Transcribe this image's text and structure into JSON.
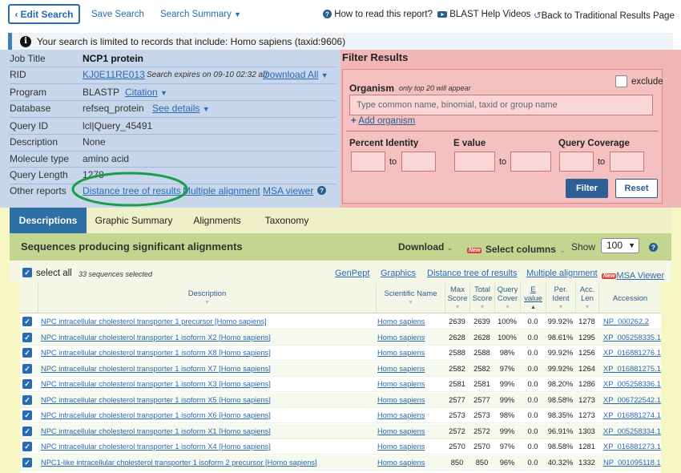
{
  "nav": {
    "edit_search": "Edit Search",
    "save_search": "Save Search",
    "search_summary": "Search Summary",
    "how_to_read": "How to read this report?",
    "blast_videos": "BLAST Help Videos",
    "back_traditional": "Back to Traditional Results Page"
  },
  "info_message": "Your search is limited to records that include: Homo sapiens (taxid:9606)",
  "job": {
    "rows": [
      {
        "label": "Job Title",
        "value": "NCP1 protein"
      },
      {
        "label": "RID",
        "value": "KJ0E11RE013",
        "extra": "Search expires on 09-10 02:32 am",
        "link": "Download All"
      },
      {
        "label": "Program",
        "value": "BLASTP",
        "link": "Citation"
      },
      {
        "label": "Database",
        "value": "refseq_protein",
        "link": "See details"
      },
      {
        "label": "Query ID",
        "value": "lcl|Query_45491"
      },
      {
        "label": "Description",
        "value": "None"
      },
      {
        "label": "Molecule type",
        "value": "amino acid"
      },
      {
        "label": "Query Length",
        "value": "1278"
      },
      {
        "label": "Other reports",
        "links": [
          "Distance tree of results",
          "Multiple alignment",
          "MSA viewer"
        ]
      }
    ]
  },
  "filter": {
    "title": "Filter Results",
    "organism_label": "Organism",
    "organism_note": "only top 20 will appear",
    "exclude_label": "exclude",
    "organism_placeholder": "Type common  name, binomial, taxid or group  name",
    "add_organism": "Add organism",
    "percent_identity": "Percent Identity",
    "e_value": "E value",
    "query_coverage": "Query Coverage",
    "to": "to",
    "filter_btn": "Filter",
    "reset_btn": "Reset"
  },
  "tabs": [
    "Descriptions",
    "Graphic Summary",
    "Alignments",
    "Taxonomy"
  ],
  "seq_header": {
    "title": "Sequences producing significant alignments",
    "download": "Download",
    "new_badge": "New",
    "select_columns": "Select columns",
    "show_label": "Show",
    "show_value": "100"
  },
  "toolbar": {
    "select_all": "select all",
    "selected_count": "33 sequences selected",
    "genpept": "GenPept",
    "graphics": "Graphics",
    "distance_tree": "Distance tree of results",
    "multiple_alignment": "Multiple alignment",
    "new_badge": "New",
    "msa_viewer": "MSA Viewer"
  },
  "table": {
    "headers": [
      "Description",
      "Scientific Name",
      "Max Score",
      "Total Score",
      "Query Cover",
      "E value",
      "Per. Ident",
      "Acc. Len",
      "Accession"
    ],
    "rows": [
      {
        "desc": "NPC intracellular cholesterol transporter 1 precursor [Homo sapiens]",
        "sci": "Homo sapiens",
        "max": "2639",
        "total": "2639",
        "cover": "100%",
        "e": "0.0",
        "ident": "99.92%",
        "len": "1278",
        "acc": "NP_000262.2"
      },
      {
        "desc": "NPC intracellular cholesterol transporter 1 isoform X2 [Homo sapiens]",
        "sci": "Homo sapiens",
        "max": "2628",
        "total": "2628",
        "cover": "100%",
        "e": "0.0",
        "ident": "98.61%",
        "len": "1295",
        "acc": "XP_005258335.1"
      },
      {
        "desc": "NPC intracellular cholesterol transporter 1 isoform X8 [Homo sapiens]",
        "sci": "Homo sapiens",
        "max": "2588",
        "total": "2588",
        "cover": "98%",
        "e": "0.0",
        "ident": "99.92%",
        "len": "1256",
        "acc": "XP_016881276.1"
      },
      {
        "desc": "NPC intracellular cholesterol transporter 1 isoform X7 [Homo sapiens]",
        "sci": "Homo sapiens",
        "max": "2582",
        "total": "2582",
        "cover": "97%",
        "e": "0.0",
        "ident": "99.92%",
        "len": "1264",
        "acc": "XP_016881275.1"
      },
      {
        "desc": "NPC intracellular cholesterol transporter 1 isoform X3 [Homo sapiens]",
        "sci": "Homo sapiens",
        "max": "2581",
        "total": "2581",
        "cover": "99%",
        "e": "0.0",
        "ident": "98.20%",
        "len": "1286",
        "acc": "XP_005258336.1"
      },
      {
        "desc": "NPC intracellular cholesterol transporter 1 isoform X5 [Homo sapiens]",
        "sci": "Homo sapiens",
        "max": "2577",
        "total": "2577",
        "cover": "99%",
        "e": "0.0",
        "ident": "98.58%",
        "len": "1273",
        "acc": "XP_006722542.1"
      },
      {
        "desc": "NPC intracellular cholesterol transporter 1 isoform X6 [Homo sapiens]",
        "sci": "Homo sapiens",
        "max": "2573",
        "total": "2573",
        "cover": "98%",
        "e": "0.0",
        "ident": "98.35%",
        "len": "1273",
        "acc": "XP_016881274.1"
      },
      {
        "desc": "NPC intracellular cholesterol transporter 1 isoform X1 [Homo sapiens]",
        "sci": "Homo sapiens",
        "max": "2572",
        "total": "2572",
        "cover": "99%",
        "e": "0.0",
        "ident": "96.91%",
        "len": "1303",
        "acc": "XP_005258334.1"
      },
      {
        "desc": "NPC intracellular cholesterol transporter 1 isoform X4 [Homo sapiens]",
        "sci": "Homo sapiens",
        "max": "2570",
        "total": "2570",
        "cover": "97%",
        "e": "0.0",
        "ident": "98.58%",
        "len": "1281",
        "acc": "XP_016881273.1"
      },
      {
        "desc": "NPC1-like intracellular cholesterol transporter 1 isoform 2 precursor [Homo sapiens]",
        "sci": "Homo sapiens",
        "max": "850",
        "total": "850",
        "cover": "96%",
        "e": "0.0",
        "ident": "40.32%",
        "len": "1332",
        "acc": "NP_001095118.1"
      }
    ]
  },
  "colors": {
    "job_panel": "#c8d6ec",
    "filter_panel": "#f2b6b6",
    "results_bg": "#f7f7c4",
    "tab_active": "#2e6fa5",
    "highlight_ellipse": "#1a9e4b"
  }
}
